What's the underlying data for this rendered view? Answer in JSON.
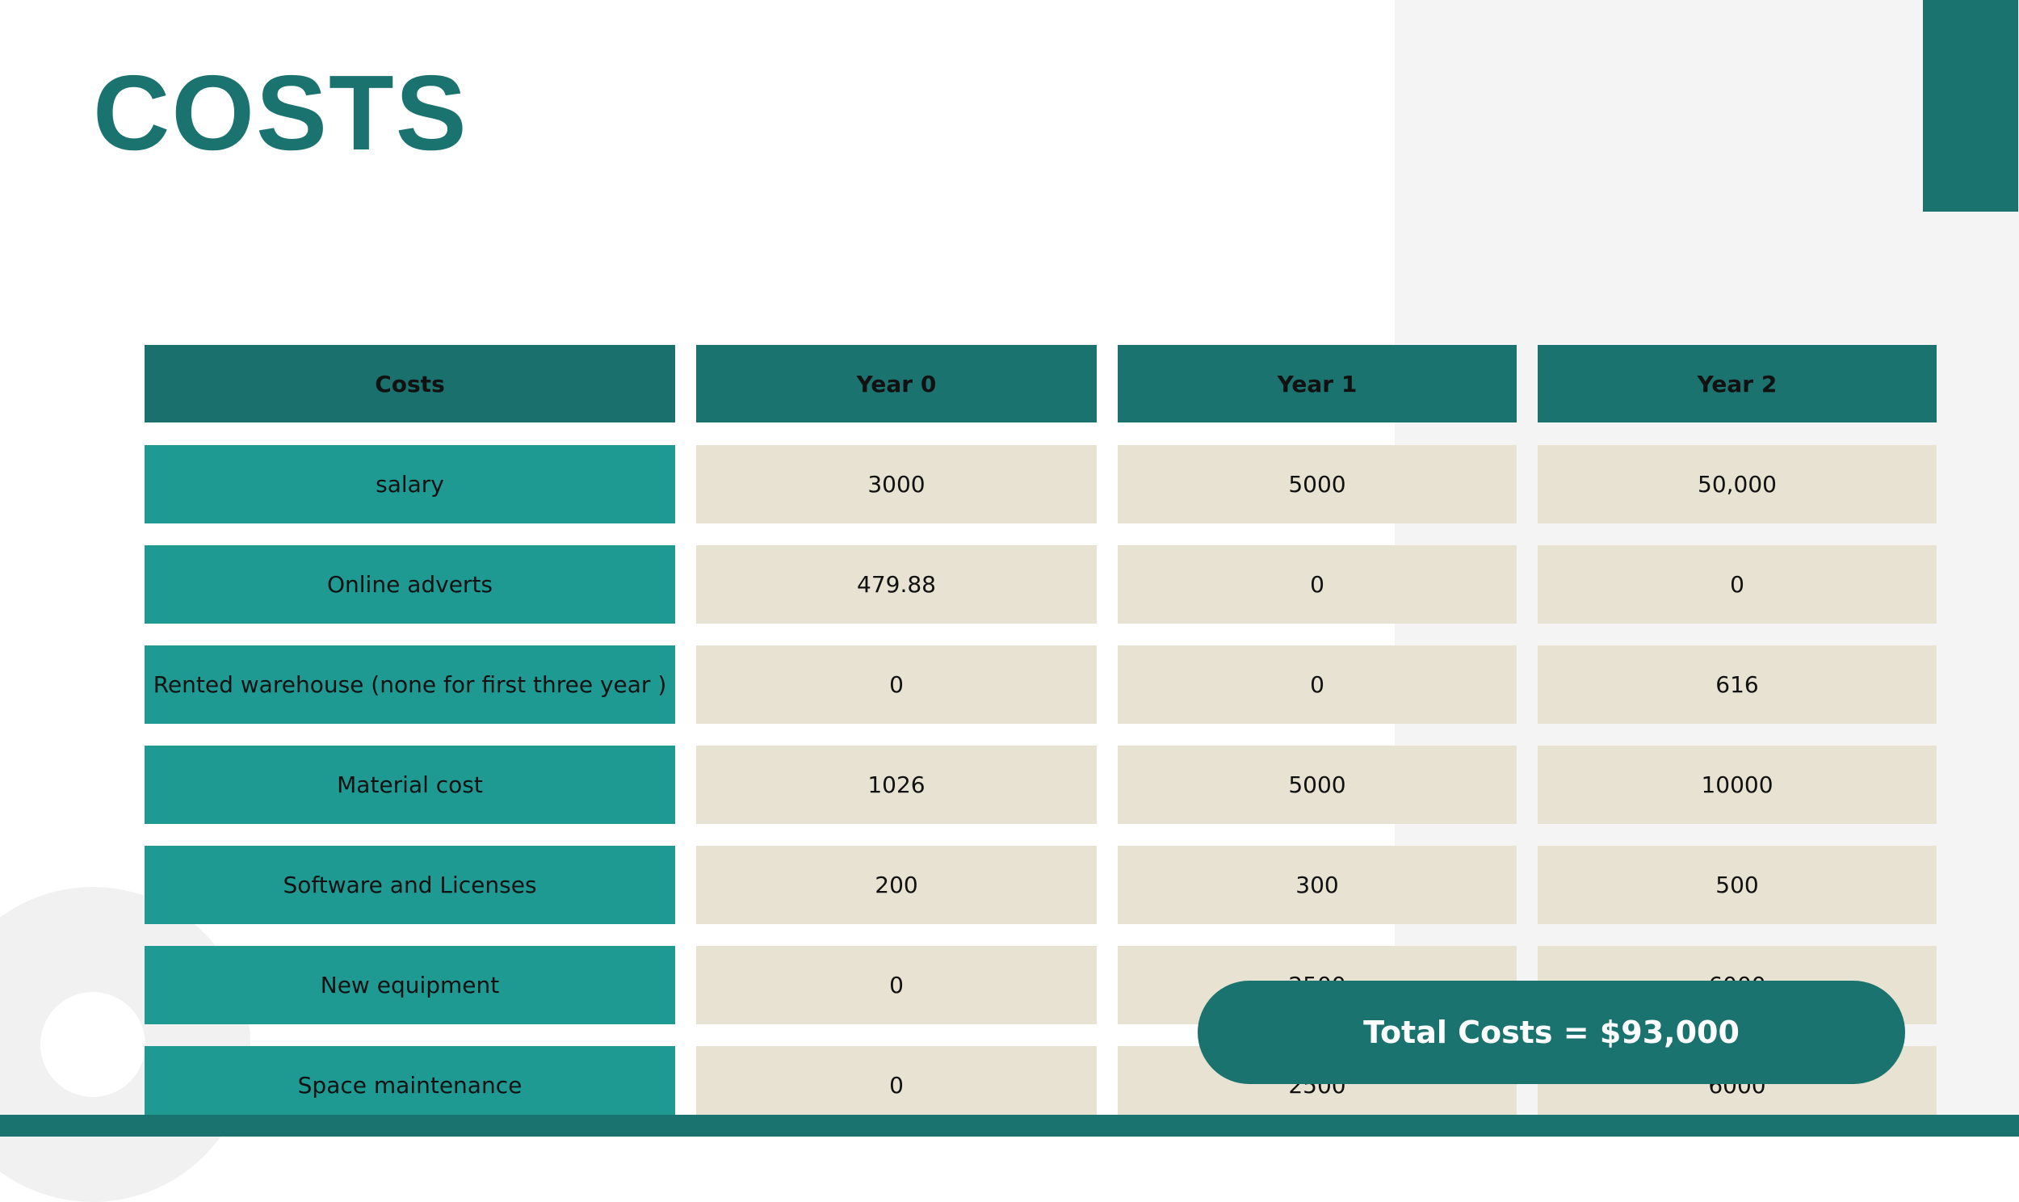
{
  "title": "COSTS",
  "table": {
    "headers": [
      "Costs",
      "Year 0",
      "Year 1",
      "Year 2"
    ],
    "rows": [
      {
        "label": "salary",
        "values": [
          "3000",
          "5000",
          "50,000"
        ]
      },
      {
        "label": "Online adverts",
        "values": [
          "479.88",
          "0",
          "0"
        ]
      },
      {
        "label": "Rented warehouse (none for first three year )",
        "values": [
          "0",
          "0",
          "616"
        ]
      },
      {
        "label": "Material cost",
        "values": [
          "1026",
          "5000",
          "10000"
        ]
      },
      {
        "label": "Software and Licenses",
        "values": [
          "200",
          "300",
          "500"
        ]
      },
      {
        "label": "New equipment",
        "values": [
          "0",
          "2500",
          "6000"
        ]
      },
      {
        "label": "Space maintenance",
        "values": [
          "0",
          "2500",
          "6000"
        ]
      }
    ]
  },
  "total_label": "Total Costs = $93,000"
}
